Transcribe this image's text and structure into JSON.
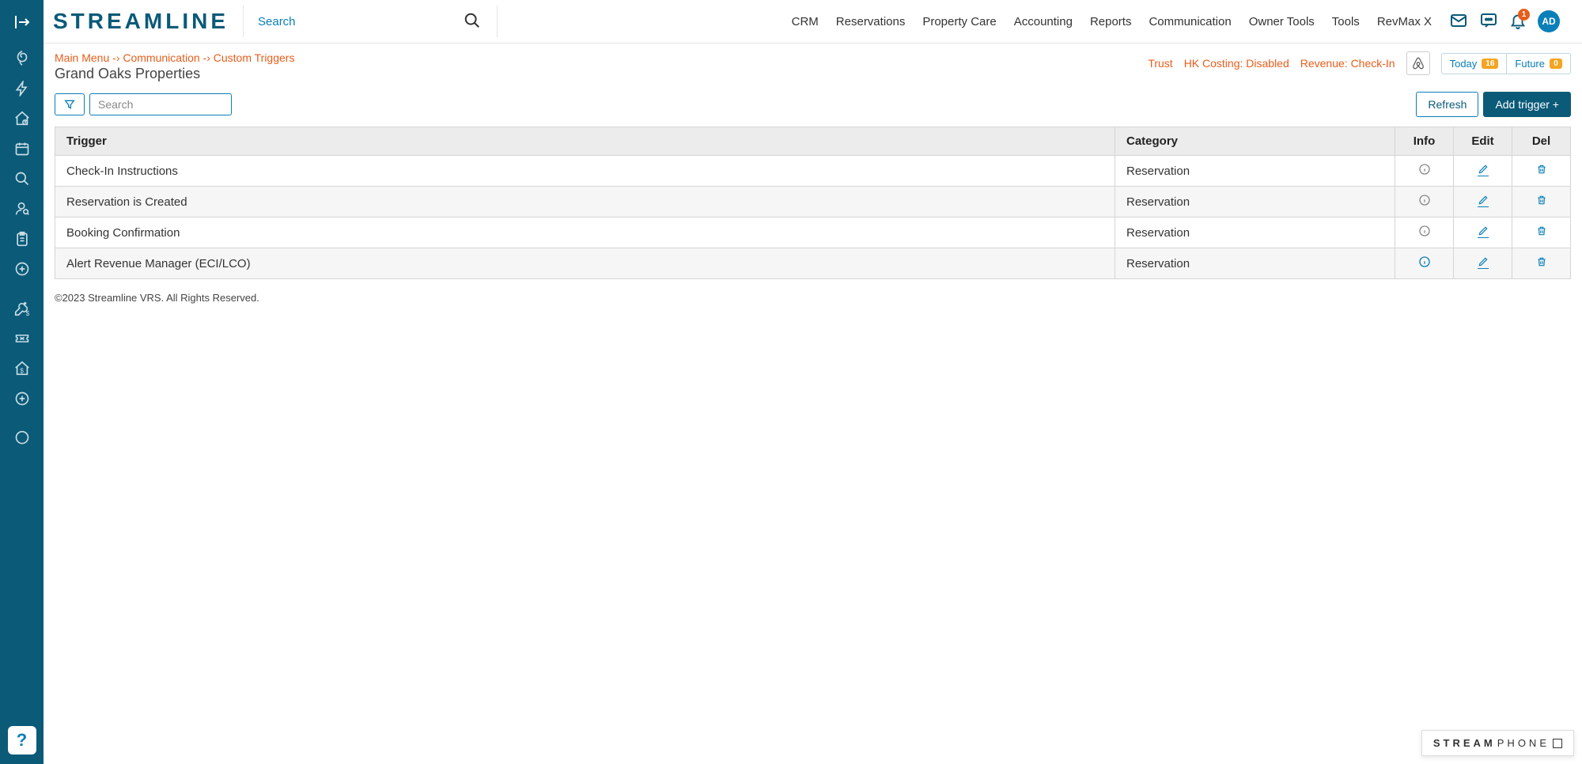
{
  "logo": "STREAMLINE",
  "header_search_placeholder": "Search",
  "nav": [
    "CRM",
    "Reservations",
    "Property Care",
    "Accounting",
    "Reports",
    "Communication",
    "Owner Tools",
    "Tools",
    "RevMax X"
  ],
  "bell_count": "1",
  "avatar_initials": "AD",
  "breadcrumb": {
    "main": "Main Menu",
    "sep": "-›",
    "mid": "Communication",
    "last": "Custom Triggers"
  },
  "page_title": "Grand Oaks Properties",
  "status": {
    "trust": "Trust",
    "hk": "HK Costing: Disabled",
    "revenue": "Revenue: Check-In",
    "today_label": "Today",
    "today_count": "16",
    "future_label": "Future",
    "future_count": "0"
  },
  "toolbar": {
    "search_placeholder": "Search",
    "refresh": "Refresh",
    "add": "Add trigger +"
  },
  "table": {
    "headers": {
      "trigger": "Trigger",
      "category": "Category",
      "info": "Info",
      "edit": "Edit",
      "del": "Del"
    },
    "rows": [
      {
        "trigger": "Check-In Instructions",
        "category": "Reservation",
        "info_active": false
      },
      {
        "trigger": "Reservation is Created",
        "category": "Reservation",
        "info_active": false
      },
      {
        "trigger": "Booking Confirmation",
        "category": "Reservation",
        "info_active": false
      },
      {
        "trigger": "Alert Revenue Manager (ECI/LCO)",
        "category": "Reservation",
        "info_active": true
      }
    ]
  },
  "footer": "©2023 Streamline VRS. All Rights Reserved.",
  "streamphone": {
    "bold": "STREAM",
    "rest": "PHONE"
  }
}
